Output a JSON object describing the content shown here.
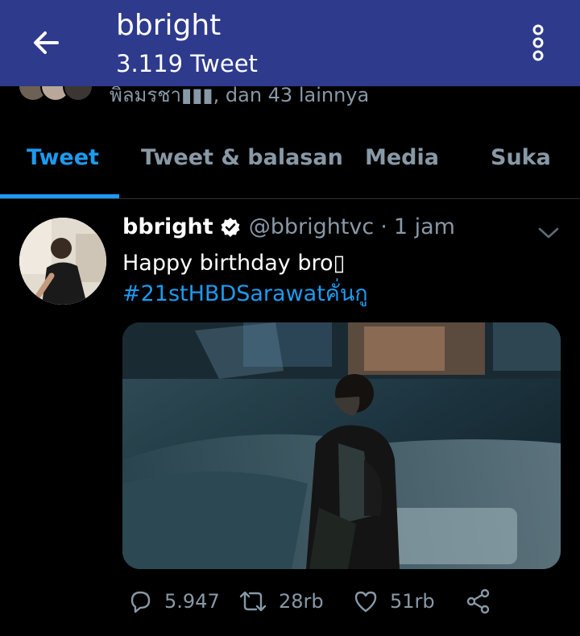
{
  "header": {
    "title": "bbright",
    "subtitle": "3.119 Tweet"
  },
  "followed_by": {
    "text": "พิลมรชา▮▮▮, dan 43 lainnya"
  },
  "tabs": [
    {
      "label": "Tweet",
      "active": true
    },
    {
      "label": "Tweet & balasan",
      "active": false
    },
    {
      "label": "Media",
      "active": false
    },
    {
      "label": "Suka",
      "active": false
    }
  ],
  "tweet": {
    "name": "bbright",
    "handle": "@bbrightvc",
    "separator": "·",
    "time": "1 jam",
    "text": "Happy birthday bro▯",
    "hashtag": "#21stHBDSarawatคั่นกู",
    "replies": "5.947",
    "retweets": "28rb",
    "likes": "51rb"
  },
  "colors": {
    "appbar": "#2e3a8c",
    "accent": "#1d9bf0",
    "muted": "#8899a6",
    "background": "#000000"
  },
  "icons": [
    "back-arrow-icon",
    "more-vertical-icon",
    "verified-badge-icon",
    "chevron-down-icon",
    "reply-icon",
    "retweet-icon",
    "like-icon",
    "share-icon"
  ]
}
